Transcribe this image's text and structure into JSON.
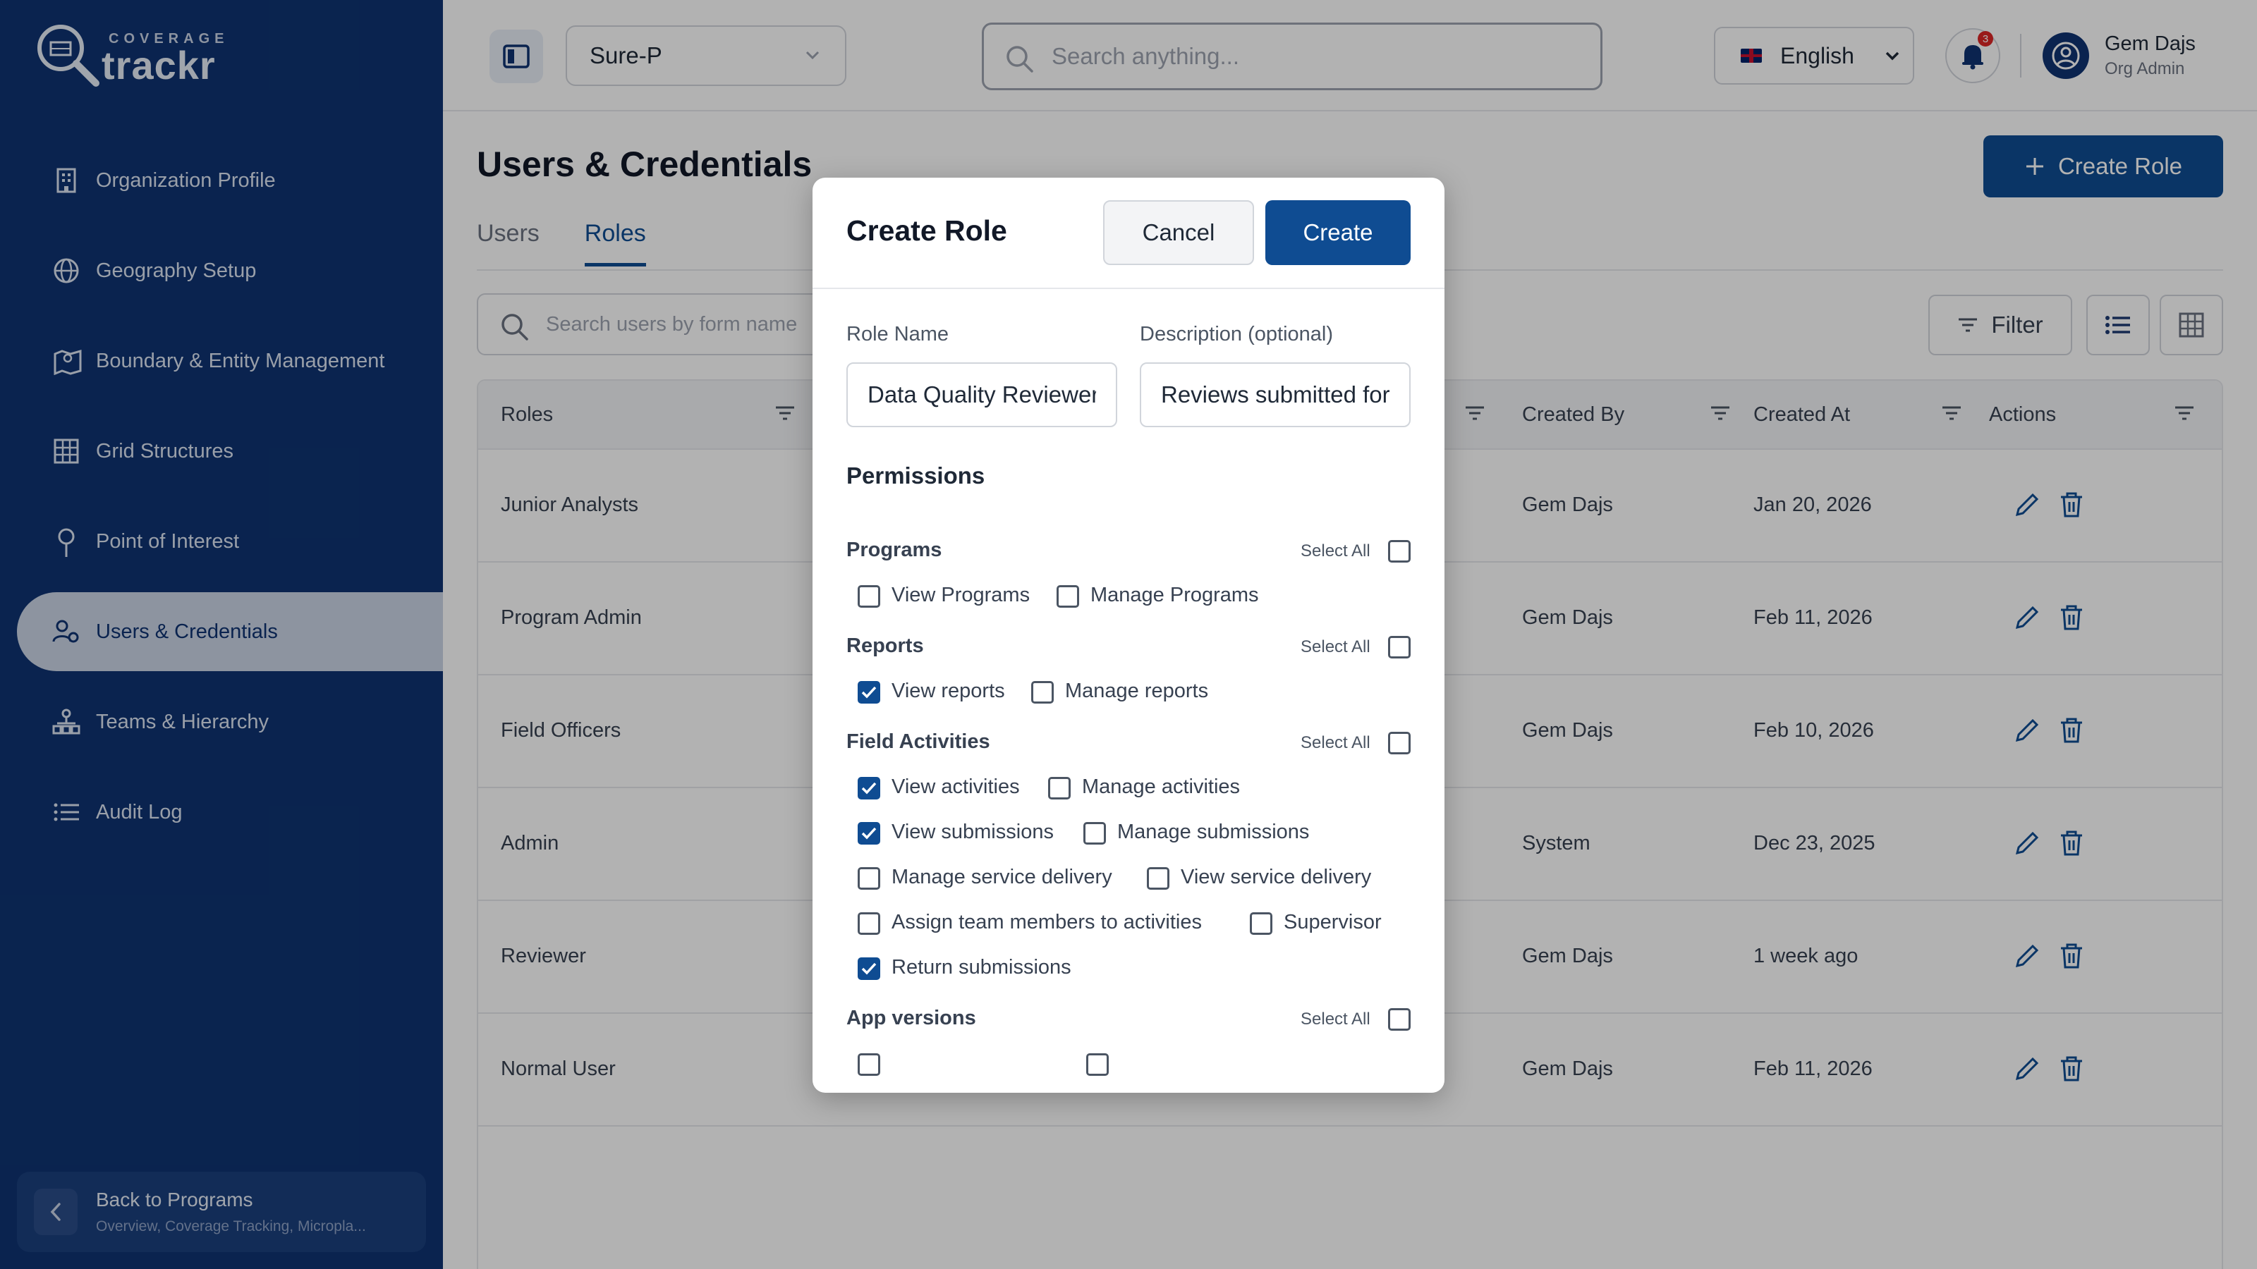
{
  "brand": {
    "top": "COVERAGE",
    "word": "trackr"
  },
  "sidebar": {
    "items": [
      {
        "label": "Organization Profile",
        "icon": "building-icon"
      },
      {
        "label": "Geography Setup",
        "icon": "globe-icon"
      },
      {
        "label": "Boundary & Entity Management",
        "icon": "map-icon"
      },
      {
        "label": "Grid Structures",
        "icon": "grid-icon"
      },
      {
        "label": "Point of Interest",
        "icon": "pin-icon"
      },
      {
        "label": "Users & Credentials",
        "icon": "users-gear-icon",
        "active": true
      },
      {
        "label": "Teams & Hierarchy",
        "icon": "hierarchy-icon"
      },
      {
        "label": "Audit Log",
        "icon": "list-icon"
      }
    ],
    "back": {
      "title": "Back to Programs",
      "subtitle": "Overview, Coverage Tracking, Micropla..."
    }
  },
  "topbar": {
    "program": "Sure-P",
    "search_placeholder": "Search anything...",
    "language": "English",
    "notifications": "3",
    "user_name": "Gem Dajs",
    "user_role": "Org Admin"
  },
  "page": {
    "title": "Users & Credentials",
    "create_role": "Create Role",
    "tabs": [
      "Users",
      "Roles"
    ],
    "table_search_placeholder": "Search users by form name",
    "filter": "Filter"
  },
  "table": {
    "headers": {
      "roles": "Roles",
      "created_by": "Created By",
      "created_at": "Created At",
      "actions": "Actions"
    },
    "rows": [
      {
        "role": "Junior Analysts",
        "created_by": "Gem Dajs",
        "created_at": "Jan 20, 2026"
      },
      {
        "role": "Program Admin",
        "created_by": "Gem Dajs",
        "created_at": "Feb 11, 2026"
      },
      {
        "role": "Field Officers",
        "created_by": "Gem Dajs",
        "created_at": "Feb 10, 2026"
      },
      {
        "role": "Admin",
        "created_by": "System",
        "created_at": "Dec 23, 2025"
      },
      {
        "role": "Reviewer",
        "created_by": "Gem Dajs",
        "created_at": "1 week ago"
      },
      {
        "role": "Normal User",
        "created_by": "Gem Dajs",
        "created_at": "Feb 11, 2026"
      }
    ]
  },
  "modal": {
    "title": "Create Role",
    "cancel": "Cancel",
    "create": "Create",
    "role_name_label": "Role Name",
    "role_name_value": "Data Quality Reviewer",
    "description_label": "Description (optional)",
    "description_value": "Reviews submitted forms",
    "permissions_title": "Permissions",
    "select_all": "Select All",
    "sections": {
      "programs": {
        "title": "Programs",
        "view": "View Programs",
        "manage": "Manage Programs"
      },
      "reports": {
        "title": "Reports",
        "view": "View reports",
        "manage": "Manage reports"
      },
      "field": {
        "title": "Field Activities",
        "view_activities": "View activities",
        "manage_activities": "Manage activities",
        "view_submissions": "View submissions",
        "manage_submissions": "Manage submissions",
        "manage_service": "Manage service delivery",
        "view_service": "View service delivery",
        "assign_team": "Assign team members to activities",
        "supervisor": "Supervisor",
        "return_submissions": "Return submissions"
      },
      "app_versions": {
        "title": "App versions"
      }
    }
  },
  "colors": {
    "sidebar": "#0f3371",
    "primary": "#0f4c92"
  }
}
